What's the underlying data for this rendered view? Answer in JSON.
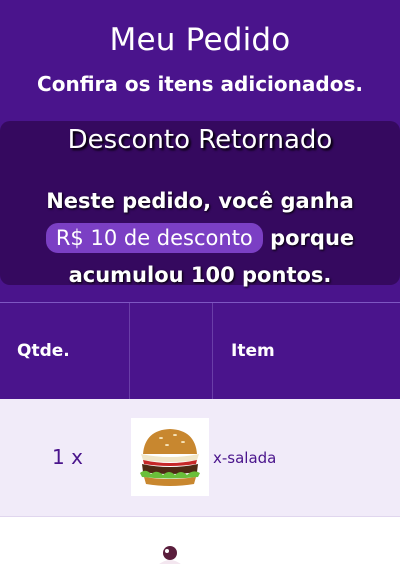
{
  "header": {
    "title": "Meu Pedido",
    "subtitle": "Confira os itens adicionados."
  },
  "discount": {
    "title": "Desconto Retornado",
    "text_before": "Neste pedido, você ganha",
    "highlight": "R$ 10 de desconto",
    "text_after": "porque acumulou 100 pontos."
  },
  "table": {
    "columns": [
      "Qtde.",
      "",
      "Item"
    ],
    "rows": [
      {
        "quantity": "1 x",
        "image_icon": "burger-icon",
        "item": "x-salada"
      },
      {
        "quantity": "",
        "image_icon": "dessert-icon",
        "item": ""
      }
    ]
  },
  "colors": {
    "primary": "#4a148c",
    "card": "#35095f",
    "pill": "#7b3fc4",
    "row_alt": "#f1ebf9"
  }
}
